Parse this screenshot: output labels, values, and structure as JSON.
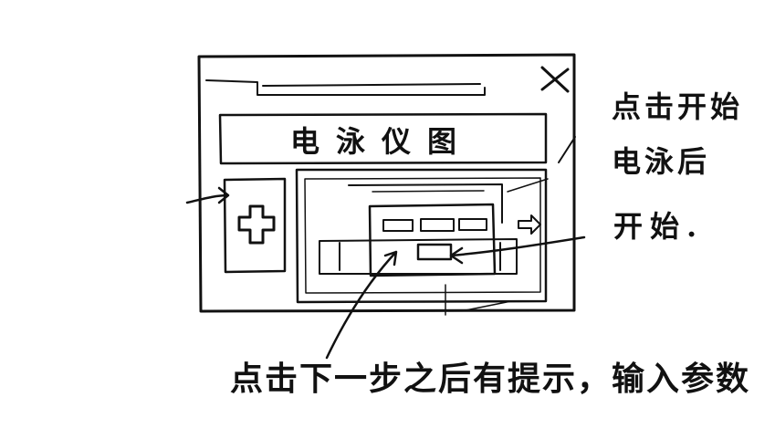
{
  "window": {
    "title": "电泳仪图",
    "close_symbol": "X"
  },
  "icons": {
    "close": "close-icon",
    "plus": "plus-icon",
    "right_arrow": "arrow-right-icon"
  },
  "annotations": {
    "top_right_line1": "点击开始",
    "top_right_line2": "电泳后",
    "top_right_line3": "开始.",
    "bottom": "点击下一步之后有提示，输入参数"
  }
}
